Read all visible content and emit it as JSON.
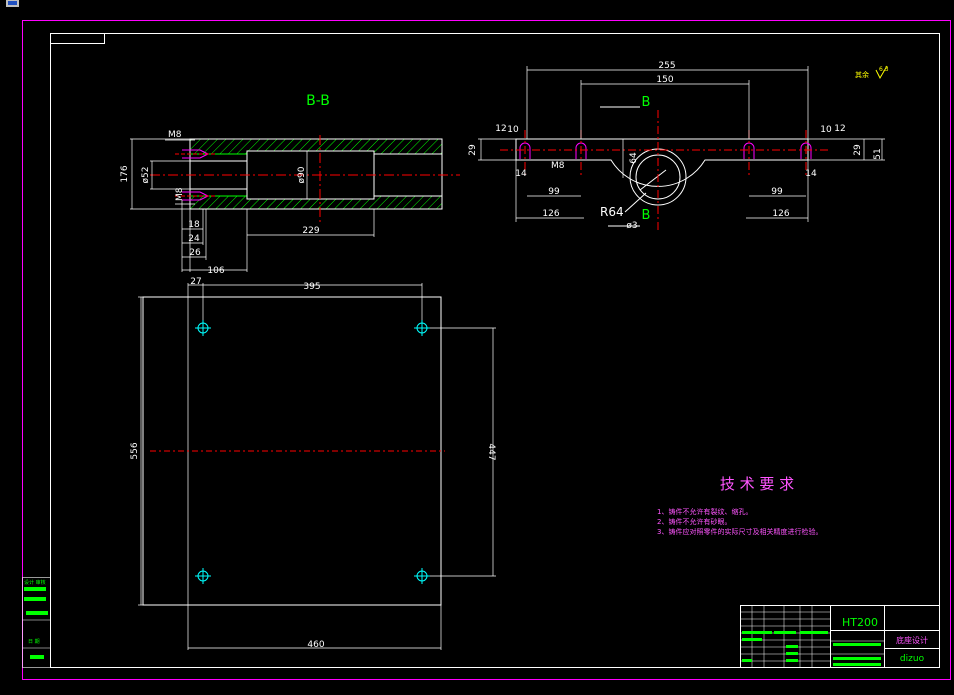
{
  "window": {
    "icon_label": "cad-window-icon"
  },
  "colors": {
    "frame": "#ff00ff",
    "line": "#ffffff",
    "center": "#ff0000",
    "hatch": "#00ff00",
    "text_magenta": "#ff55ff",
    "text_green": "#00ff00",
    "text_yellow": "#ffff00",
    "text_cyan": "#00ffff"
  },
  "section_view": {
    "title": "B-B",
    "dims": {
      "m8_top": "M8",
      "m8_bottom": "M8",
      "d52": "ø52",
      "h176": "176",
      "d90": "ø90",
      "l18": "18",
      "l24": "24",
      "l26": "26",
      "l106": "106",
      "l229": "229"
    }
  },
  "top_view": {
    "section_mark_top": "B",
    "section_mark_bottom": "B",
    "radius_label": "R64",
    "m8_label": "M8",
    "dims": {
      "w255": "255",
      "w150": "150",
      "l12": "12",
      "l10": "10",
      "r10": "10",
      "r12": "12",
      "h29_left": "29",
      "h29_right": "29",
      "h51": "51",
      "h64": "64",
      "l14": "14",
      "r14": "14",
      "l99": "99",
      "r99": "99",
      "l126": "126",
      "r126": "126",
      "d": "ø3"
    }
  },
  "roughness": {
    "label": "其余",
    "value": "6.3"
  },
  "plate_view": {
    "dims": {
      "w27": "27",
      "w395": "395",
      "h556": "556",
      "h447": "447",
      "w460": "460"
    }
  },
  "tech_requirements": {
    "title": "技 术 要 求",
    "items": [
      "1、铸件不允许有裂纹、缩孔。",
      "2、铸件不允许有砂眼。",
      "3、铸件应对照零件的实际尺寸及相关精度进行检验。"
    ]
  },
  "title_block": {
    "material": "HT200",
    "part_name": "底座设计",
    "drawing_code": "dizuo"
  },
  "side_table": {
    "label_top": "设计 审核",
    "label_mid": "日 期"
  }
}
